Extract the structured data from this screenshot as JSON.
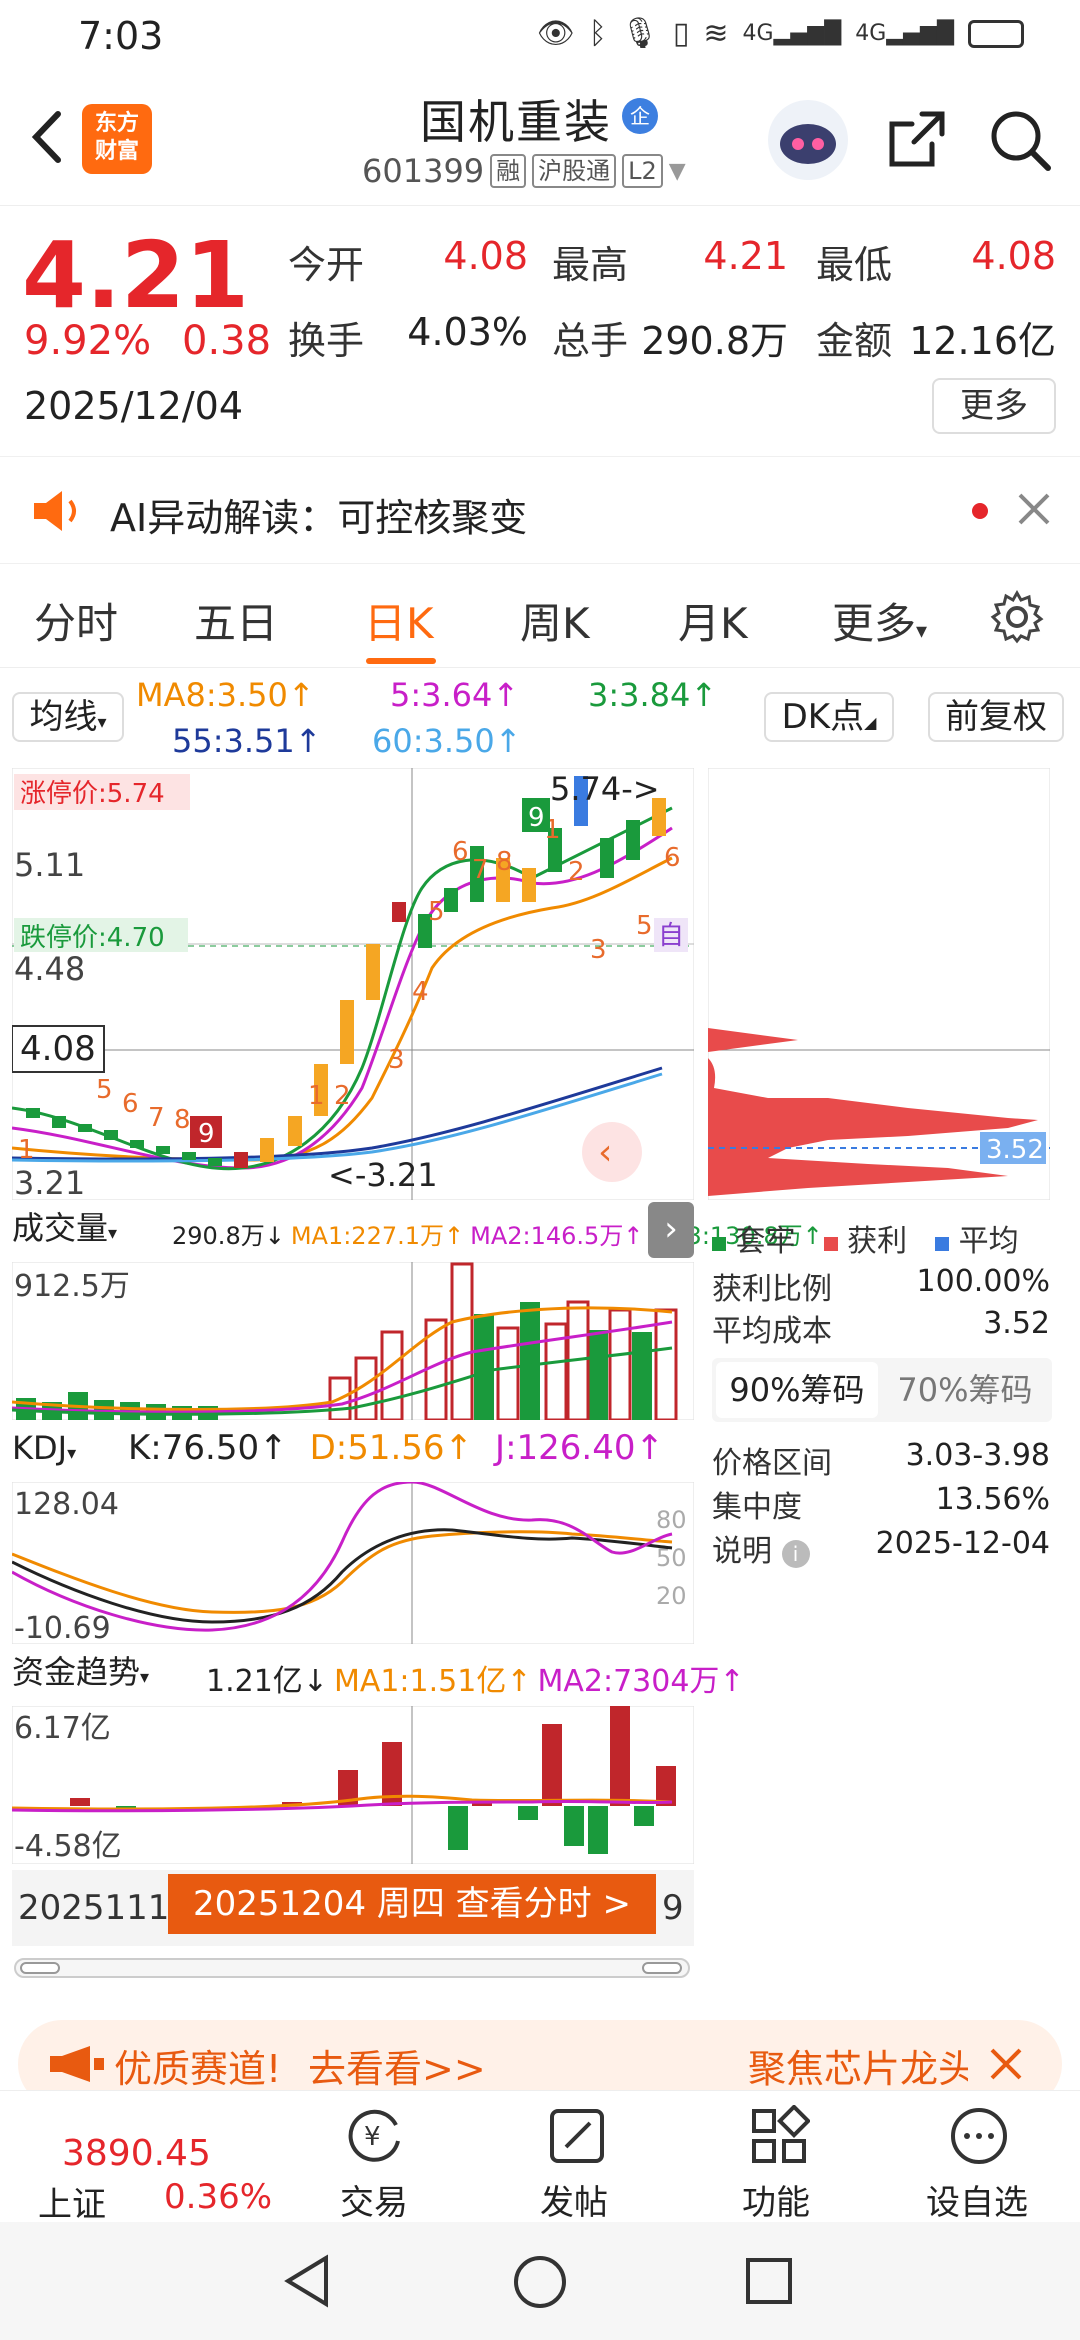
{
  "status": {
    "time": "7:03",
    "net1": "4G",
    "net2": "4G"
  },
  "header": {
    "logo_line1": "东方",
    "logo_line2": "财富",
    "name": "国机重装",
    "name_badge": "企",
    "code": "601399",
    "tag1": "融",
    "tag2": "沪股通",
    "tag3": "L2"
  },
  "quote": {
    "price": "4.21",
    "pct": "9.92%",
    "change": "0.38",
    "date": "2025/12/04",
    "open_label": "今开",
    "open": "4.08",
    "high_label": "最高",
    "high": "4.21",
    "low_label": "最低",
    "low": "4.08",
    "turnover_label": "换手",
    "turnover": "4.03%",
    "volume_label": "总手",
    "volume": "290.8万",
    "amount_label": "金额",
    "amount": "12.16亿",
    "more": "更多"
  },
  "ai": {
    "text": "AI异动解读：可控核聚变"
  },
  "tabs": [
    "分时",
    "五日",
    "日K",
    "周K",
    "月K",
    "更多"
  ],
  "active_tab": "日K",
  "ma": {
    "selector": "均线",
    "ma8": "MA8:3.50↑",
    "ma5": "5:3.64↑",
    "ma3": "3:3.84↑",
    "ma55": "55:3.51↑",
    "ma60": "60:3.50↑",
    "dk": "DK点",
    "fq": "前复权"
  },
  "kline": {
    "limit_up": "涨停价:5.74",
    "limit_down": "跌停价:4.70",
    "y1": "5.11",
    "y2": "4.48",
    "y3": "3.21",
    "cross_price": "4.08",
    "max_label": "5.74->",
    "min_label": "<-3.21",
    "self_label": "自"
  },
  "chip": {
    "avg_price": "3.52"
  },
  "volume": {
    "selector": "成交量",
    "v": "290.8万↓",
    "ma1": "MA1:227.1万↑",
    "ma2": "MA2:146.5万↑",
    "ma3": "MA3:130.8万↑",
    "max": "912.5万"
  },
  "kdj": {
    "selector": "KDJ",
    "k": "K:76.50↑",
    "d": "D:51.56↑",
    "j": "J:126.40↑",
    "top": "128.04",
    "bottom": "-10.69",
    "l80": "80",
    "l50": "50",
    "l20": "20"
  },
  "fund": {
    "selector": "资金趋势",
    "v": "1.21亿↓",
    "ma1": "MA1:1.51亿↑",
    "ma2": "MA2:7304万↑",
    "top": "6.17亿",
    "bottom": "-4.58亿"
  },
  "timeline": {
    "left_date": "2025111",
    "tooltip": "20251204 周四 查看分时 >",
    "right": "9"
  },
  "chip_panel": {
    "legend_trap": "套牢",
    "legend_profit": "获利",
    "legend_avg": "平均",
    "profit_ratio_label": "获利比例",
    "profit_ratio": "100.00%",
    "avg_cost_label": "平均成本",
    "avg_cost": "3.52",
    "tab90": "90%筹码",
    "tab70": "70%筹码",
    "range_label": "价格区间",
    "range": "3.03-3.98",
    "concentration_label": "集中度",
    "concentration": "13.56%",
    "note_label": "说明",
    "note_date": "2025-12-04"
  },
  "banner": {
    "text1": "优质赛道!",
    "text2": "去看看>>",
    "text3": "聚焦芯片龙头"
  },
  "bottom": {
    "index_value": "3890.45",
    "index_name": "上证",
    "index_pct": "0.36%",
    "trade": "交易",
    "post": "发帖",
    "func": "功能",
    "watch": "设自选"
  },
  "colors": {
    "up": "#e5262b",
    "down": "#1a9a3c",
    "accent": "#ff6a10"
  }
}
